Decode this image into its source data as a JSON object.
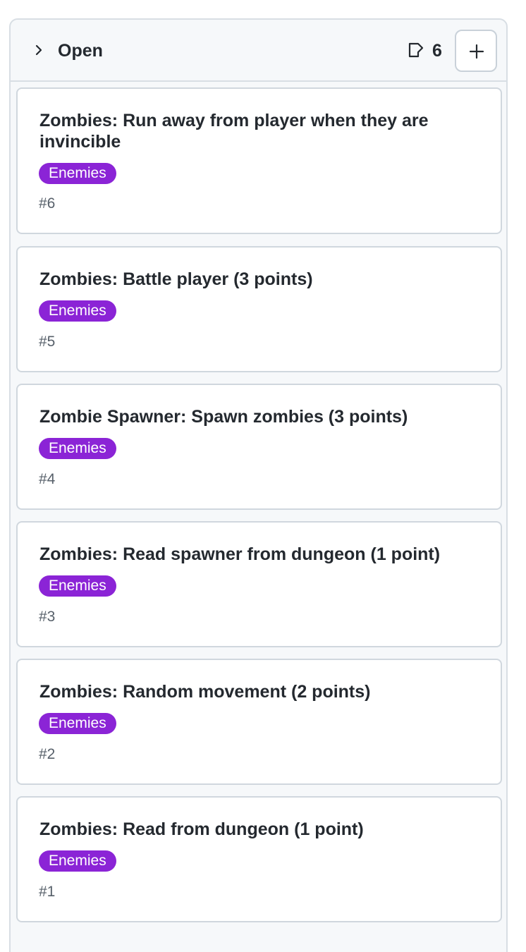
{
  "column": {
    "title": "Open",
    "count": "6",
    "icons": {
      "collapse": "chevron-right-icon",
      "card": "card-icon",
      "add": "plus-icon"
    }
  },
  "colors": {
    "label_bg": "#8b24d6",
    "label_text": "#ffffff",
    "border": "#d0d7de"
  },
  "cards": [
    {
      "title": "Zombies: Run away from player when they are invincible",
      "label": "Enemies",
      "number": "#6"
    },
    {
      "title": "Zombies: Battle player (3 points)",
      "label": "Enemies",
      "number": "#5"
    },
    {
      "title": "Zombie Spawner: Spawn zombies (3 points)",
      "label": "Enemies",
      "number": "#4"
    },
    {
      "title": "Zombies: Read spawner from dungeon (1 point)",
      "label": "Enemies",
      "number": "#3"
    },
    {
      "title": "Zombies: Random movement (2 points)",
      "label": "Enemies",
      "number": "#2"
    },
    {
      "title": "Zombies: Read from dungeon (1 point)",
      "label": "Enemies",
      "number": "#1"
    }
  ]
}
